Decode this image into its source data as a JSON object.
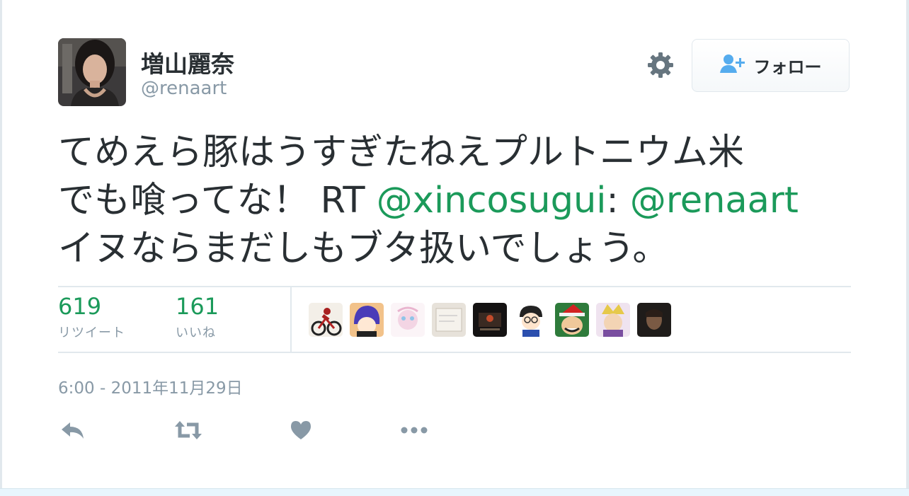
{
  "user": {
    "name": "増山麗奈",
    "handle": "@renaart",
    "avatar_icon": "user-avatar"
  },
  "header": {
    "settings_icon": "gear-icon",
    "follow": {
      "icon": "follow-user-plus-icon",
      "label": "フォロー"
    }
  },
  "tweet": {
    "line1": "てめえら豚はうすぎたねえプルトニウム米",
    "line2_prefix": "でも喰ってな！ RT ",
    "mention1": "@xincosugui",
    "colon": ":",
    "mention2": "@renaart",
    "line3": "イヌならまだしもブタ扱いでしょう。"
  },
  "stats": {
    "retweets": {
      "count": "619",
      "label": "リツイート"
    },
    "likes": {
      "count": "161",
      "label": "いいね"
    }
  },
  "likers_count": 9,
  "timestamp": "6:00 - 2011年11月29日",
  "actions": {
    "reply_icon": "reply-icon",
    "retweet_icon": "retweet-icon",
    "like_icon": "heart-icon",
    "more_icon": "more-dots-icon"
  },
  "colors": {
    "link": "#1b9a5a",
    "muted": "#8899a6",
    "text": "#292f33",
    "border": "#e1e8ed",
    "icon": "#8899a6",
    "follow_icon": "#55acee"
  }
}
